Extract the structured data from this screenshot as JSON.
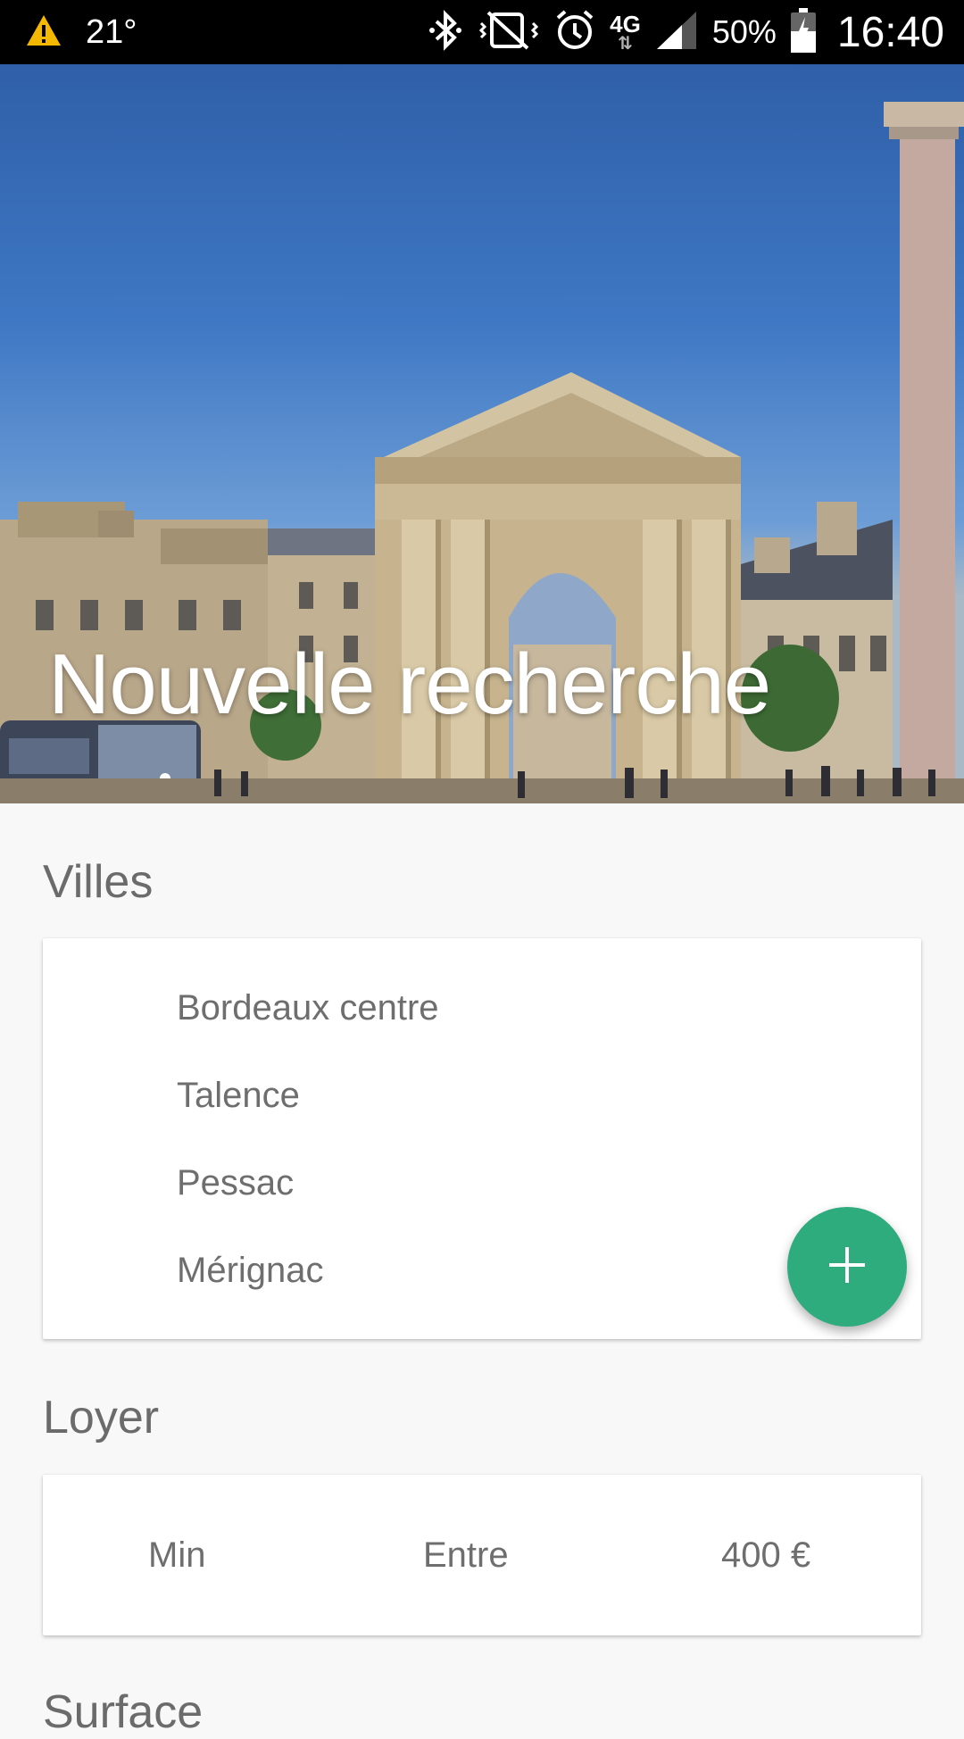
{
  "status_bar": {
    "icons_left": [
      "warning-icon"
    ],
    "temperature": "21°",
    "icons_right": [
      "bluetooth-icon",
      "vibrate-icon",
      "alarm-icon",
      "network-4g-icon",
      "signal-icon",
      "battery-icon"
    ],
    "network_label": "4G",
    "battery": "50%",
    "time": "16:40"
  },
  "hero": {
    "title": "Nouvelle recherche",
    "image": "bordeaux-porte-city-photo"
  },
  "cities_section": {
    "title": "Villes",
    "items": [
      "Bordeaux centre",
      "Talence",
      "Pessac",
      "Mérignac"
    ],
    "add_button_icon": "plus-icon"
  },
  "rent_section": {
    "title": "Loyer",
    "min_label": "Min",
    "between_label": "Entre",
    "value": "400 €"
  },
  "surface_section": {
    "title": "Surface"
  },
  "colors": {
    "accent": "#2fac7e",
    "status_bar": "#000000",
    "background": "#f8f8f8"
  }
}
